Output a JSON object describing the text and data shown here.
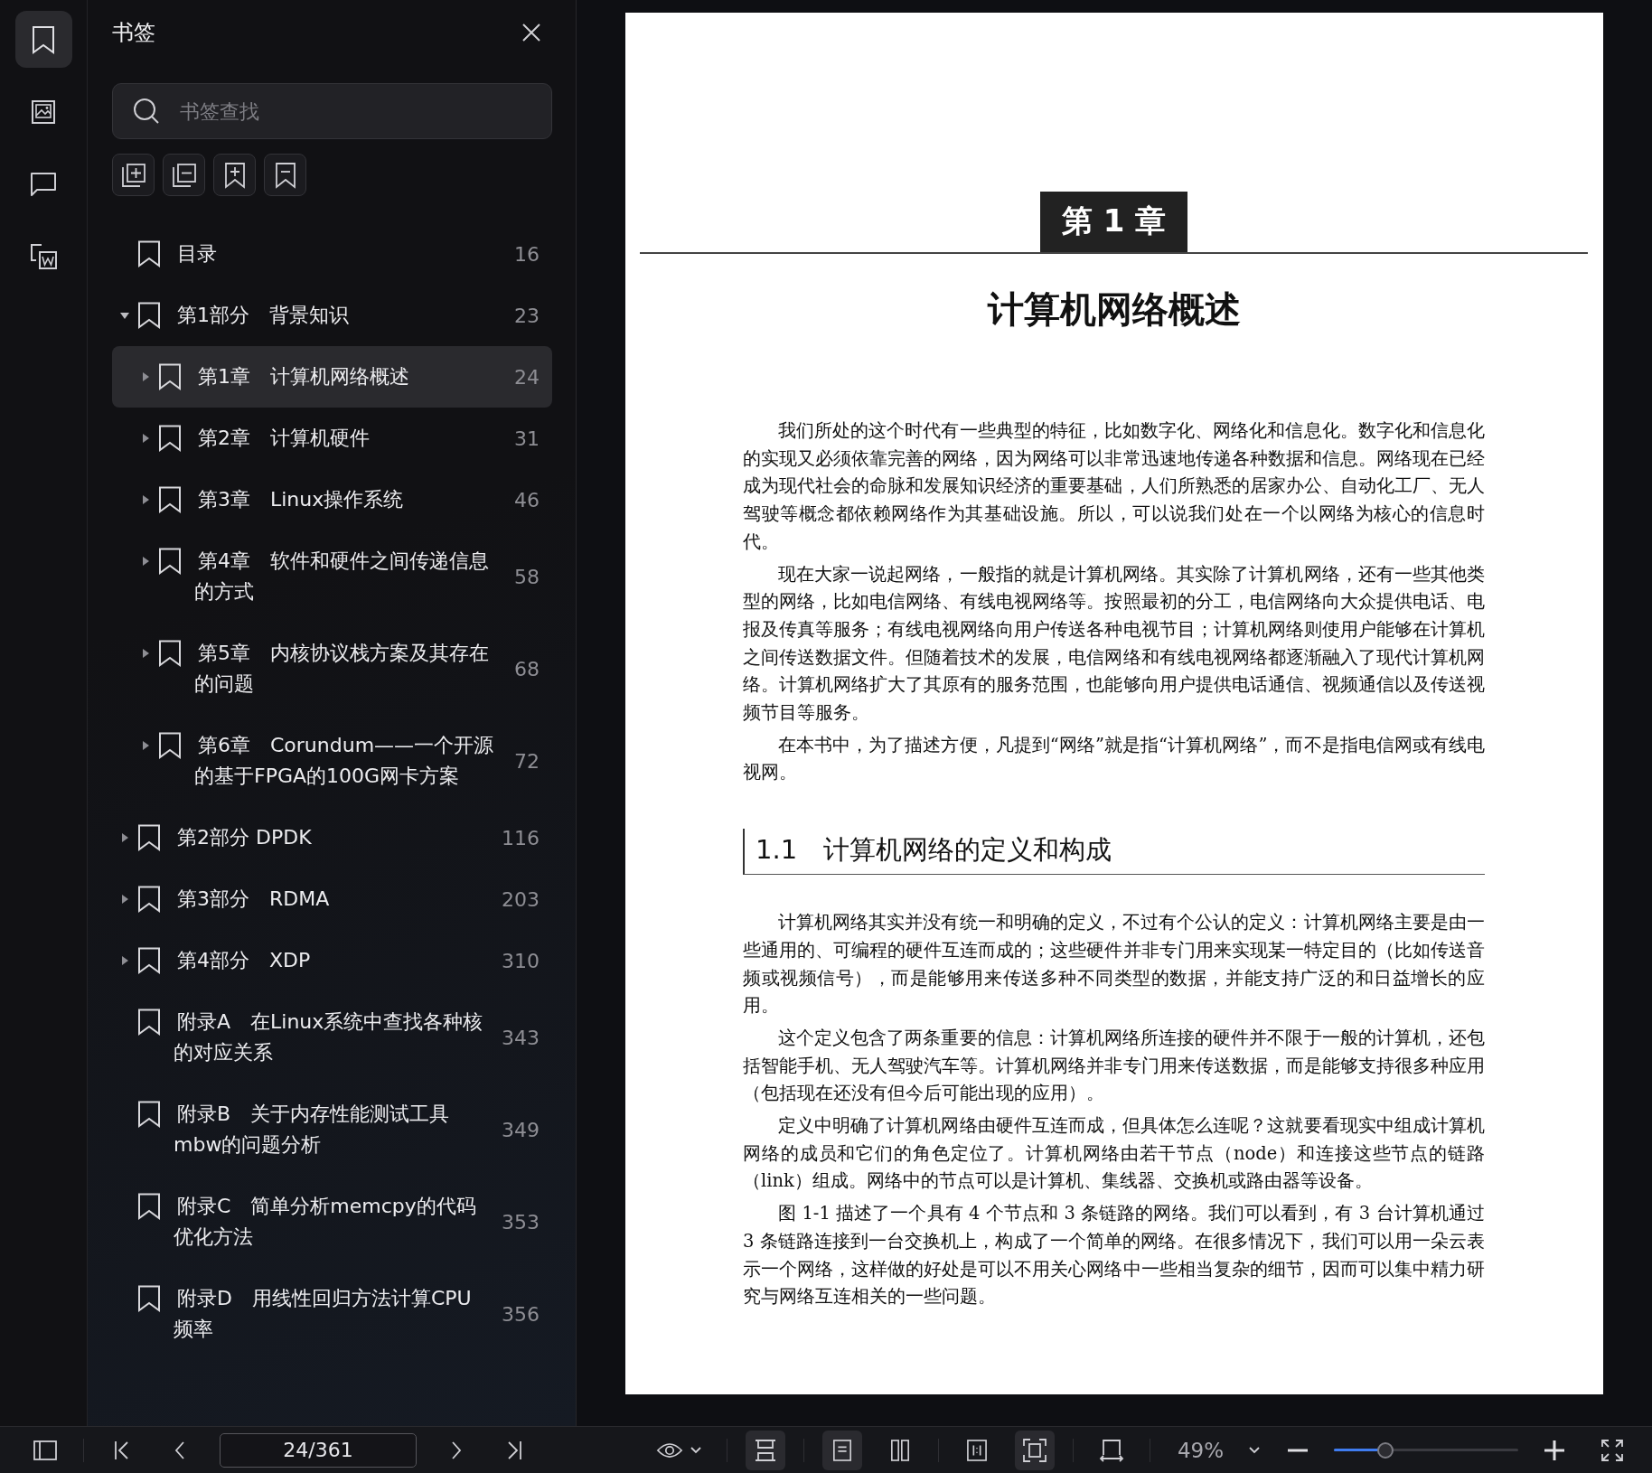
{
  "rail": [
    {
      "kind": "bookmarks",
      "selected": true
    },
    {
      "kind": "thumbnails",
      "selected": false
    },
    {
      "kind": "comments",
      "selected": false
    },
    {
      "kind": "convert",
      "selected": false
    }
  ],
  "panel": {
    "title": "书签",
    "search": {
      "placeholder": "书签查找"
    }
  },
  "bookmarks": [
    {
      "label": "目录",
      "page": "16",
      "selected": false
    },
    {
      "label": "第1部分　背景知识",
      "page": "23",
      "expanded": true,
      "selected": false,
      "children": [
        {
          "label": "第1章　计算机网络概述",
          "page": "24",
          "expanded": false,
          "selected": true
        },
        {
          "label": "第2章　计算机硬件",
          "page": "31",
          "expanded": false,
          "selected": false
        },
        {
          "label": "第3章　Linux操作系统",
          "page": "46",
          "expanded": false,
          "selected": false
        },
        {
          "label": "第4章　软件和硬件之间传递信息的方式",
          "page": "58",
          "expanded": false,
          "selected": false
        },
        {
          "label": "第5章　内核协议栈方案及其存在的问题",
          "page": "68",
          "expanded": false,
          "selected": false
        },
        {
          "label": "第6章　Corundum——一个开源的基于FPGA的100G网卡方案",
          "page": "72",
          "expanded": false,
          "selected": false
        }
      ]
    },
    {
      "label": "第2部分 DPDK",
      "page": "116",
      "expanded": false,
      "selected": false
    },
    {
      "label": "第3部分　RDMA",
      "page": "203",
      "expanded": false,
      "selected": false
    },
    {
      "label": "第4部分　XDP",
      "page": "310",
      "expanded": false,
      "selected": false
    },
    {
      "label": "附录A　在Linux系统中查找各种核的对应关系",
      "page": "343",
      "selected": false
    },
    {
      "label": "附录B　关于内存性能测试工具mbw的问题分析",
      "page": "349",
      "selected": false
    },
    {
      "label": "附录C　简单分析memcpy的代码优化方法",
      "page": "353",
      "selected": false
    },
    {
      "label": "附录D　用线性回归方法计算CPU频率",
      "page": "356",
      "selected": false
    }
  ],
  "document": {
    "chapter_label": "第 1 章",
    "title": "计算机网络概述",
    "paragraphs": [
      "我们所处的这个时代有一些典型的特征，比如数字化、网络化和信息化。数字化和信息化的实现又必须依靠完善的网络，因为网络可以非常迅速地传递各种数据和信息。网络现在已经成为现代社会的命脉和发展知识经济的重要基础，人们所熟悉的居家办公、自动化工厂、无人驾驶等概念都依赖网络作为其基础设施。所以，可以说我们处在一个以网络为核心的信息时代。",
      "现在大家一说起网络，一般指的就是计算机网络。其实除了计算机网络，还有一些其他类型的网络，比如电信网络、有线电视网络等。按照最初的分工，电信网络向大众提供电话、电报及传真等服务；有线电视网络向用户传送各种电视节目；计算机网络则使用户能够在计算机之间传送数据文件。但随着技术的发展，电信网络和有线电视网络都逐渐融入了现代计算机网络。计算机网络扩大了其原有的服务范围，也能够向用户提供电话通信、视频通信以及传送视频节目等服务。",
      "在本书中，为了描述方便，凡提到“网络”就是指“计算机网络”，而不是指电信网或有线电视网。"
    ],
    "section_heading": "1.1　计算机网络的定义和构成",
    "section_paragraphs": [
      "计算机网络其实并没有统一和明确的定义，不过有个公认的定义：计算机网络主要是由一些通用的、可编程的硬件互连而成的；这些硬件并非专门用来实现某一特定目的（比如传送音频或视频信号），而是能够用来传送多种不同类型的数据，并能支持广泛的和日益增长的应用。",
      "这个定义包含了两条重要的信息：计算机网络所连接的硬件并不限于一般的计算机，还包括智能手机、无人驾驶汽车等。计算机网络并非专门用来传送数据，而是能够支持很多种应用（包括现在还没有但今后可能出现的应用）。",
      "定义中明确了计算机网络由硬件互连而成，但具体怎么连呢？这就要看现实中组成计算机网络的成员和它们的角色定位了。计算机网络由若干节点（node）和连接这些节点的链路（link）组成。网络中的节点可以是计算机、集线器、交换机或路由器等设备。",
      "图 1-1 描述了一个具有 4 个节点和 3 条链路的网络。我们可以看到，有 3 台计算机通过 3 条链路连接到一台交换机上，构成了一个简单的网络。在很多情况下，我们可以用一朵云表示一个网络，这样做的好处是可以不用关心网络中一些相当复杂的细节，因而可以集中精力研究与网络互连相关的一些问题。"
    ]
  },
  "toolbar": {
    "page_field": "24/361",
    "view_buttons": [
      {
        "kind": "continuous",
        "selected": true
      },
      {
        "kind": "single",
        "selected": true
      },
      {
        "kind": "double",
        "selected": false
      },
      {
        "kind": "actual",
        "selected": false
      },
      {
        "kind": "fit",
        "selected": true
      },
      {
        "kind": "width",
        "selected": false
      }
    ],
    "zoom": "49%",
    "zoom_slider": {
      "level": 0.28
    }
  }
}
